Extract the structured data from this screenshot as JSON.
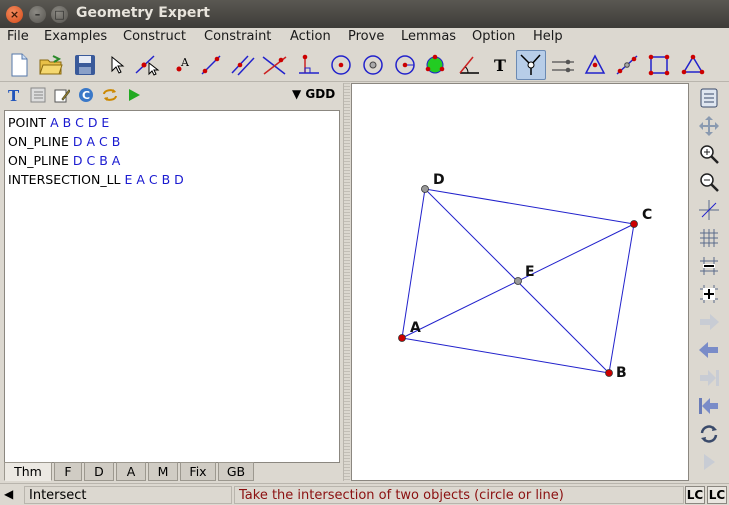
{
  "window": {
    "title": "Geometry Expert"
  },
  "menubar": [
    "File",
    "Examples",
    "Construct",
    "Constraint",
    "Action",
    "Prove",
    "Lemmas",
    "Option",
    "Help"
  ],
  "left_panel": {
    "prover_label": "GDD",
    "theorem": [
      {
        "cmd": "POINT",
        "args": "A B C D E"
      },
      {
        "cmd": "ON_PLINE",
        "args": "D A C B"
      },
      {
        "cmd": "ON_PLINE",
        "args": "D C B A"
      },
      {
        "cmd": "INTERSECTION_LL",
        "args": "E A C B D"
      }
    ],
    "tabs": [
      "Thm",
      "F",
      "D",
      "A",
      "M",
      "Fix",
      "GB"
    ],
    "selected_tab": "Thm"
  },
  "canvas": {
    "points": {
      "A": {
        "label": "A",
        "color": "#cc0000"
      },
      "B": {
        "label": "B",
        "color": "#cc0000"
      },
      "C": {
        "label": "C",
        "color": "#cc0000"
      },
      "D": {
        "label": "D",
        "color": "#999999"
      },
      "E": {
        "label": "E",
        "color": "#999999"
      }
    },
    "segments": [
      [
        "D",
        "C"
      ],
      [
        "D",
        "A"
      ],
      [
        "A",
        "B"
      ],
      [
        "B",
        "C"
      ],
      [
        "A",
        "C"
      ],
      [
        "D",
        "B"
      ]
    ],
    "line_color": "#2222cc"
  },
  "status": {
    "tool": "Intersect",
    "message": "Take the intersection of two objects (circle or line)",
    "lc1": "LC",
    "lc2": "LC"
  }
}
